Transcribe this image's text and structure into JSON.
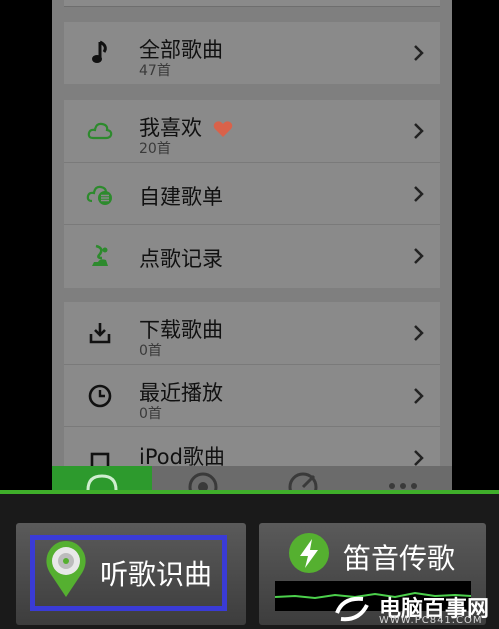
{
  "library": {
    "all_songs": {
      "title": "全部歌曲",
      "count": "47首"
    },
    "favorites": {
      "title": "我喜欢",
      "count": "20首"
    },
    "custom_playlist": {
      "title": "自建歌单"
    },
    "song_requests": {
      "title": "点歌记录"
    },
    "downloads": {
      "title": "下载歌曲",
      "count": "0首"
    },
    "recent": {
      "title": "最近播放",
      "count": "0首"
    },
    "ipod": {
      "title": "iPod歌曲"
    }
  },
  "actions": {
    "identify": {
      "label": "听歌识曲"
    },
    "whistle": {
      "label": "笛音传歌"
    }
  },
  "watermark": {
    "text": "电脑百事网",
    "url": "WWW.PC841.COM"
  },
  "colors": {
    "accent": "#3fae2a",
    "highlight": "#3a3bd6",
    "heart": "#d9624a"
  }
}
